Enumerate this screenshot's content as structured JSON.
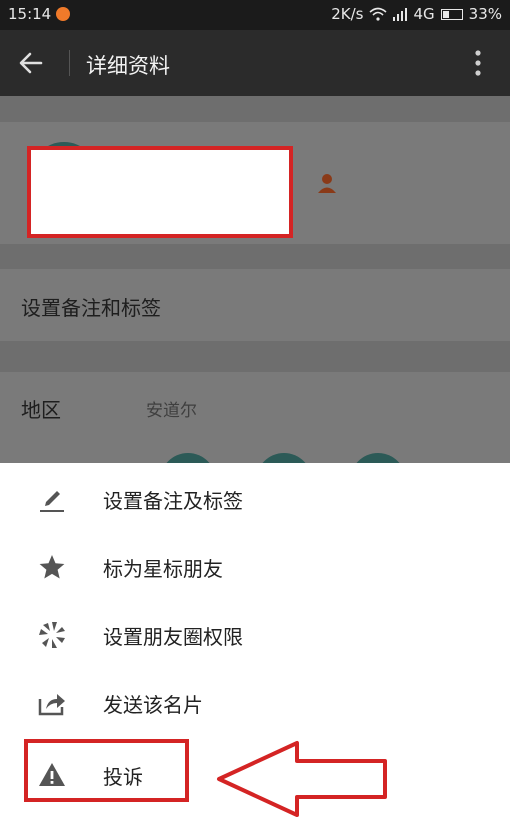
{
  "status_bar": {
    "time": "15:14",
    "network_speed": "2K/s",
    "network_type": "4G",
    "battery_percent": "33%",
    "battery_level": 0.33
  },
  "app_bar": {
    "title": "详细资料",
    "back_icon": "arrow-left-icon",
    "more_icon": "more-vertical-icon"
  },
  "profile": {
    "icon": "person-icon"
  },
  "rows": {
    "remark_label": "设置备注和标签",
    "region_label": "地区",
    "region_value": "安道尔"
  },
  "menu": {
    "items": [
      {
        "label": "设置备注及标签",
        "icon": "pencil-icon"
      },
      {
        "label": "标为星标朋友",
        "icon": "star-icon"
      },
      {
        "label": "设置朋友圈权限",
        "icon": "aperture-icon"
      },
      {
        "label": "发送该名片",
        "icon": "share-icon"
      },
      {
        "label": "投诉",
        "icon": "warning-icon"
      }
    ]
  },
  "colors": {
    "annotation_red": "#d42424",
    "app_bar_bg": "#2b2b2b",
    "overlay_bg": "#6e6e6e"
  }
}
